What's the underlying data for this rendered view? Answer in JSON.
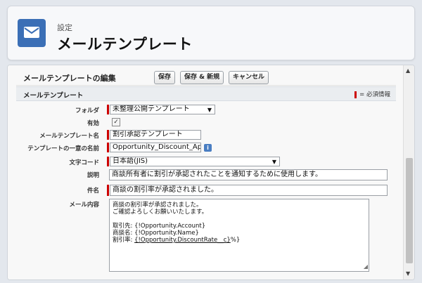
{
  "header": {
    "subtitle": "設定",
    "title": "メールテンプレート",
    "icon": "envelope-icon"
  },
  "form": {
    "edit_title": "メールテンプレートの編集",
    "buttons": {
      "save": "保存",
      "save_new": "保存 & 新規",
      "cancel": "キャンセル"
    },
    "section_title": "メールテンプレート",
    "required_legend": "= 必須情報",
    "fields": {
      "folder": {
        "label": "フォルダ",
        "value": "未整理公開テンプレート"
      },
      "active": {
        "label": "有効",
        "checked": "✓"
      },
      "template_name": {
        "label": "メールテンプレート名",
        "value": "割引承認テンプレート"
      },
      "unique_name": {
        "label": "テンプレートの一意の名前",
        "value": "Opportunity_Discount_App"
      },
      "encoding": {
        "label": "文字コード",
        "value": "日本語(JIS)"
      },
      "description": {
        "label": "説明",
        "value": "商談所有者に割引が承認されたことを通知するために使用します。"
      },
      "subject": {
        "label": "件名",
        "value": "商談の割引率が承認されました。"
      },
      "body": {
        "label": "メール内容",
        "line1": "商談の割引率が承認されました。",
        "line2": "ご確認よろしくお願いいたします。",
        "line3": "取引先: {!Opportunity.Account}",
        "line4": "商談名: {!Opportunity.Name}",
        "line5_prefix": "割引率: ",
        "line5_merge": "{!Opportunity.DiscountRate__c}",
        "line5_suffix": "%}"
      }
    }
  },
  "colors": {
    "accent": "#3b6fb6",
    "required": "#cc0000"
  }
}
